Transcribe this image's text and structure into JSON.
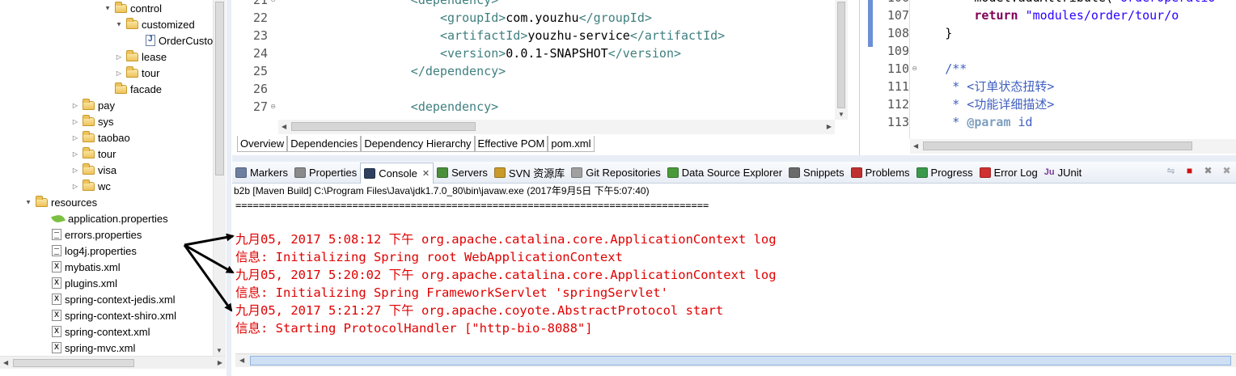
{
  "explorer": {
    "items": [
      {
        "label": "control",
        "icon": "folder-icon",
        "expander": "▲",
        "expanded": true
      },
      {
        "label": "customized",
        "icon": "folder-icon",
        "expander": "▲",
        "expanded": true
      },
      {
        "label": "OrderCusto",
        "icon": "java-file-icon",
        "expander": ""
      },
      {
        "label": "lease",
        "icon": "folder-icon",
        "expander": "▷"
      },
      {
        "label": "tour",
        "icon": "folder-icon",
        "expander": "▷"
      },
      {
        "label": "facade",
        "icon": "folder-icon",
        "expander": ""
      },
      {
        "label": "pay",
        "icon": "folder-icon",
        "expander": "▷"
      },
      {
        "label": "sys",
        "icon": "folder-icon",
        "expander": "▷"
      },
      {
        "label": "taobao",
        "icon": "folder-icon",
        "expander": "▷"
      },
      {
        "label": "tour",
        "icon": "folder-icon",
        "expander": "▷"
      },
      {
        "label": "visa",
        "icon": "folder-icon",
        "expander": "▷"
      },
      {
        "label": "wc",
        "icon": "folder-icon",
        "expander": "▷"
      },
      {
        "label": "resources",
        "icon": "folder-icon",
        "expander": "▲",
        "expanded": true
      },
      {
        "label": "application.properties",
        "icon": "spring-leaf-icon",
        "expander": ""
      },
      {
        "label": "errors.properties",
        "icon": "properties-file-icon",
        "expander": ""
      },
      {
        "label": "log4j.properties",
        "icon": "properties-file-icon",
        "expander": ""
      },
      {
        "label": "mybatis.xml",
        "icon": "xml-file-icon",
        "expander": ""
      },
      {
        "label": "plugins.xml",
        "icon": "xml-file-icon",
        "expander": ""
      },
      {
        "label": "spring-context-jedis.xml",
        "icon": "xml-file-icon",
        "expander": ""
      },
      {
        "label": "spring-context-shiro.xml",
        "icon": "xml-file-icon",
        "expander": ""
      },
      {
        "label": "spring-context.xml",
        "icon": "xml-file-icon",
        "expander": ""
      },
      {
        "label": "spring-mvc.xml",
        "icon": "xml-file-icon",
        "expander": ""
      }
    ]
  },
  "pom_editor": {
    "lines": [
      {
        "num": "21",
        "fold": true,
        "indent": 16,
        "parts": [
          {
            "c": "tag",
            "t": "<dependency>"
          }
        ]
      },
      {
        "num": "22",
        "indent": 20,
        "parts": [
          {
            "c": "tag",
            "t": "<groupId>"
          },
          {
            "c": "txt",
            "t": "com.youzhu"
          },
          {
            "c": "tag",
            "t": "</groupId>"
          }
        ]
      },
      {
        "num": "23",
        "indent": 20,
        "parts": [
          {
            "c": "tag",
            "t": "<artifactId>"
          },
          {
            "c": "txt",
            "t": "youzhu-service"
          },
          {
            "c": "tag",
            "t": "</artifactId>"
          }
        ]
      },
      {
        "num": "24",
        "indent": 20,
        "parts": [
          {
            "c": "tag",
            "t": "<version>"
          },
          {
            "c": "txt",
            "t": "0.0.1-SNAPSHOT"
          },
          {
            "c": "tag",
            "t": "</version>"
          }
        ]
      },
      {
        "num": "25",
        "indent": 16,
        "parts": [
          {
            "c": "tag",
            "t": "</dependency>"
          }
        ]
      },
      {
        "num": "26",
        "indent": 0,
        "parts": []
      },
      {
        "num": "27",
        "fold": true,
        "indent": 16,
        "parts": [
          {
            "c": "tag",
            "t": "<dependency>"
          }
        ]
      }
    ],
    "tabs": [
      "Overview",
      "Dependencies",
      "Dependency Hierarchy",
      "Effective POM",
      "pom.xml"
    ],
    "active_tab": "pom.xml"
  },
  "java_editor": {
    "lines": [
      {
        "num": "106",
        "indent": 8,
        "parts": [
          {
            "c": "txt",
            "t": "model.addAttribute("
          },
          {
            "c": "str",
            "t": "\"orderOperatio"
          }
        ]
      },
      {
        "num": "107",
        "indent": 8,
        "parts": [
          {
            "c": "kw",
            "t": "return"
          },
          {
            "c": "txt",
            "t": " "
          },
          {
            "c": "str",
            "t": "\"modules/order/tour/o"
          }
        ]
      },
      {
        "num": "108",
        "indent": 4,
        "parts": [
          {
            "c": "txt",
            "t": "}"
          }
        ]
      },
      {
        "num": "109",
        "indent": 0,
        "parts": []
      },
      {
        "num": "110",
        "fold": true,
        "indent": 4,
        "parts": [
          {
            "c": "doc",
            "t": "/**"
          }
        ]
      },
      {
        "num": "111",
        "indent": 5,
        "parts": [
          {
            "c": "doc",
            "t": "* <订单状态扭转>"
          }
        ]
      },
      {
        "num": "112",
        "indent": 5,
        "parts": [
          {
            "c": "doc",
            "t": "* <功能详细描述>"
          }
        ]
      },
      {
        "num": "113",
        "indent": 5,
        "parts": [
          {
            "c": "doc",
            "t": "* "
          },
          {
            "c": "docb",
            "t": "@param"
          },
          {
            "c": "doc",
            "t": " id"
          }
        ]
      }
    ]
  },
  "views": {
    "tabs": [
      {
        "label": "Markers",
        "icon": "markers-icon",
        "color": "#6f7fa0"
      },
      {
        "label": "Properties",
        "icon": "properties-icon",
        "color": "#8a8a8a"
      },
      {
        "label": "Console",
        "icon": "console-icon",
        "color": "#2f3f5f",
        "active": true
      },
      {
        "label": "Servers",
        "icon": "servers-icon",
        "color": "#4a8f3a"
      },
      {
        "label": "SVN 资源库",
        "icon": "svn-icon",
        "color": "#c99a2a"
      },
      {
        "label": "Git Repositories",
        "icon": "git-icon",
        "color": "#a0a0a0"
      },
      {
        "label": "Data Source Explorer",
        "icon": "data-source-icon",
        "color": "#4a9a3a"
      },
      {
        "label": "Snippets",
        "icon": "snippets-icon",
        "color": "#6a6a6a"
      },
      {
        "label": "Problems",
        "icon": "problems-icon",
        "color": "#c03030"
      },
      {
        "label": "Progress",
        "icon": "progress-icon",
        "color": "#3a9a4a"
      },
      {
        "label": "Error Log",
        "icon": "error-log-icon",
        "color": "#d03030"
      },
      {
        "label": "JUnit",
        "icon": "junit-icon",
        "color": "#7a3a9a",
        "prefix": "Ju"
      }
    ],
    "tools": [
      {
        "name": "pin-console-icon",
        "glyph": "⇋",
        "color": "#9aa6b8"
      },
      {
        "name": "terminate-icon",
        "glyph": "■",
        "color": "#d01010"
      },
      {
        "name": "remove-launch-icon",
        "glyph": "✖",
        "color": "#8a8a8a"
      },
      {
        "name": "remove-all-launches-icon",
        "glyph": "✖",
        "color": "#a0a0a0"
      }
    ]
  },
  "console": {
    "description": "b2b [Maven Build] C:\\Program Files\\Java\\jdk1.7.0_80\\bin\\javaw.exe (2017年9月5日 下午5:07:40)",
    "separator": "=================================================================================",
    "lines": [
      "九月05, 2017 5:08:12 下午 org.apache.catalina.core.ApplicationContext log",
      "信息: Initializing Spring root WebApplicationContext",
      "九月05, 2017 5:20:02 下午 org.apache.catalina.core.ApplicationContext log",
      "信息: Initializing Spring FrameworkServlet 'springServlet'",
      "九月05, 2017 5:21:27 下午 org.apache.coyote.AbstractProtocol start",
      "信息: Starting ProtocolHandler [\"http-bio-8088\"]"
    ],
    "text_color": "#e00000"
  }
}
